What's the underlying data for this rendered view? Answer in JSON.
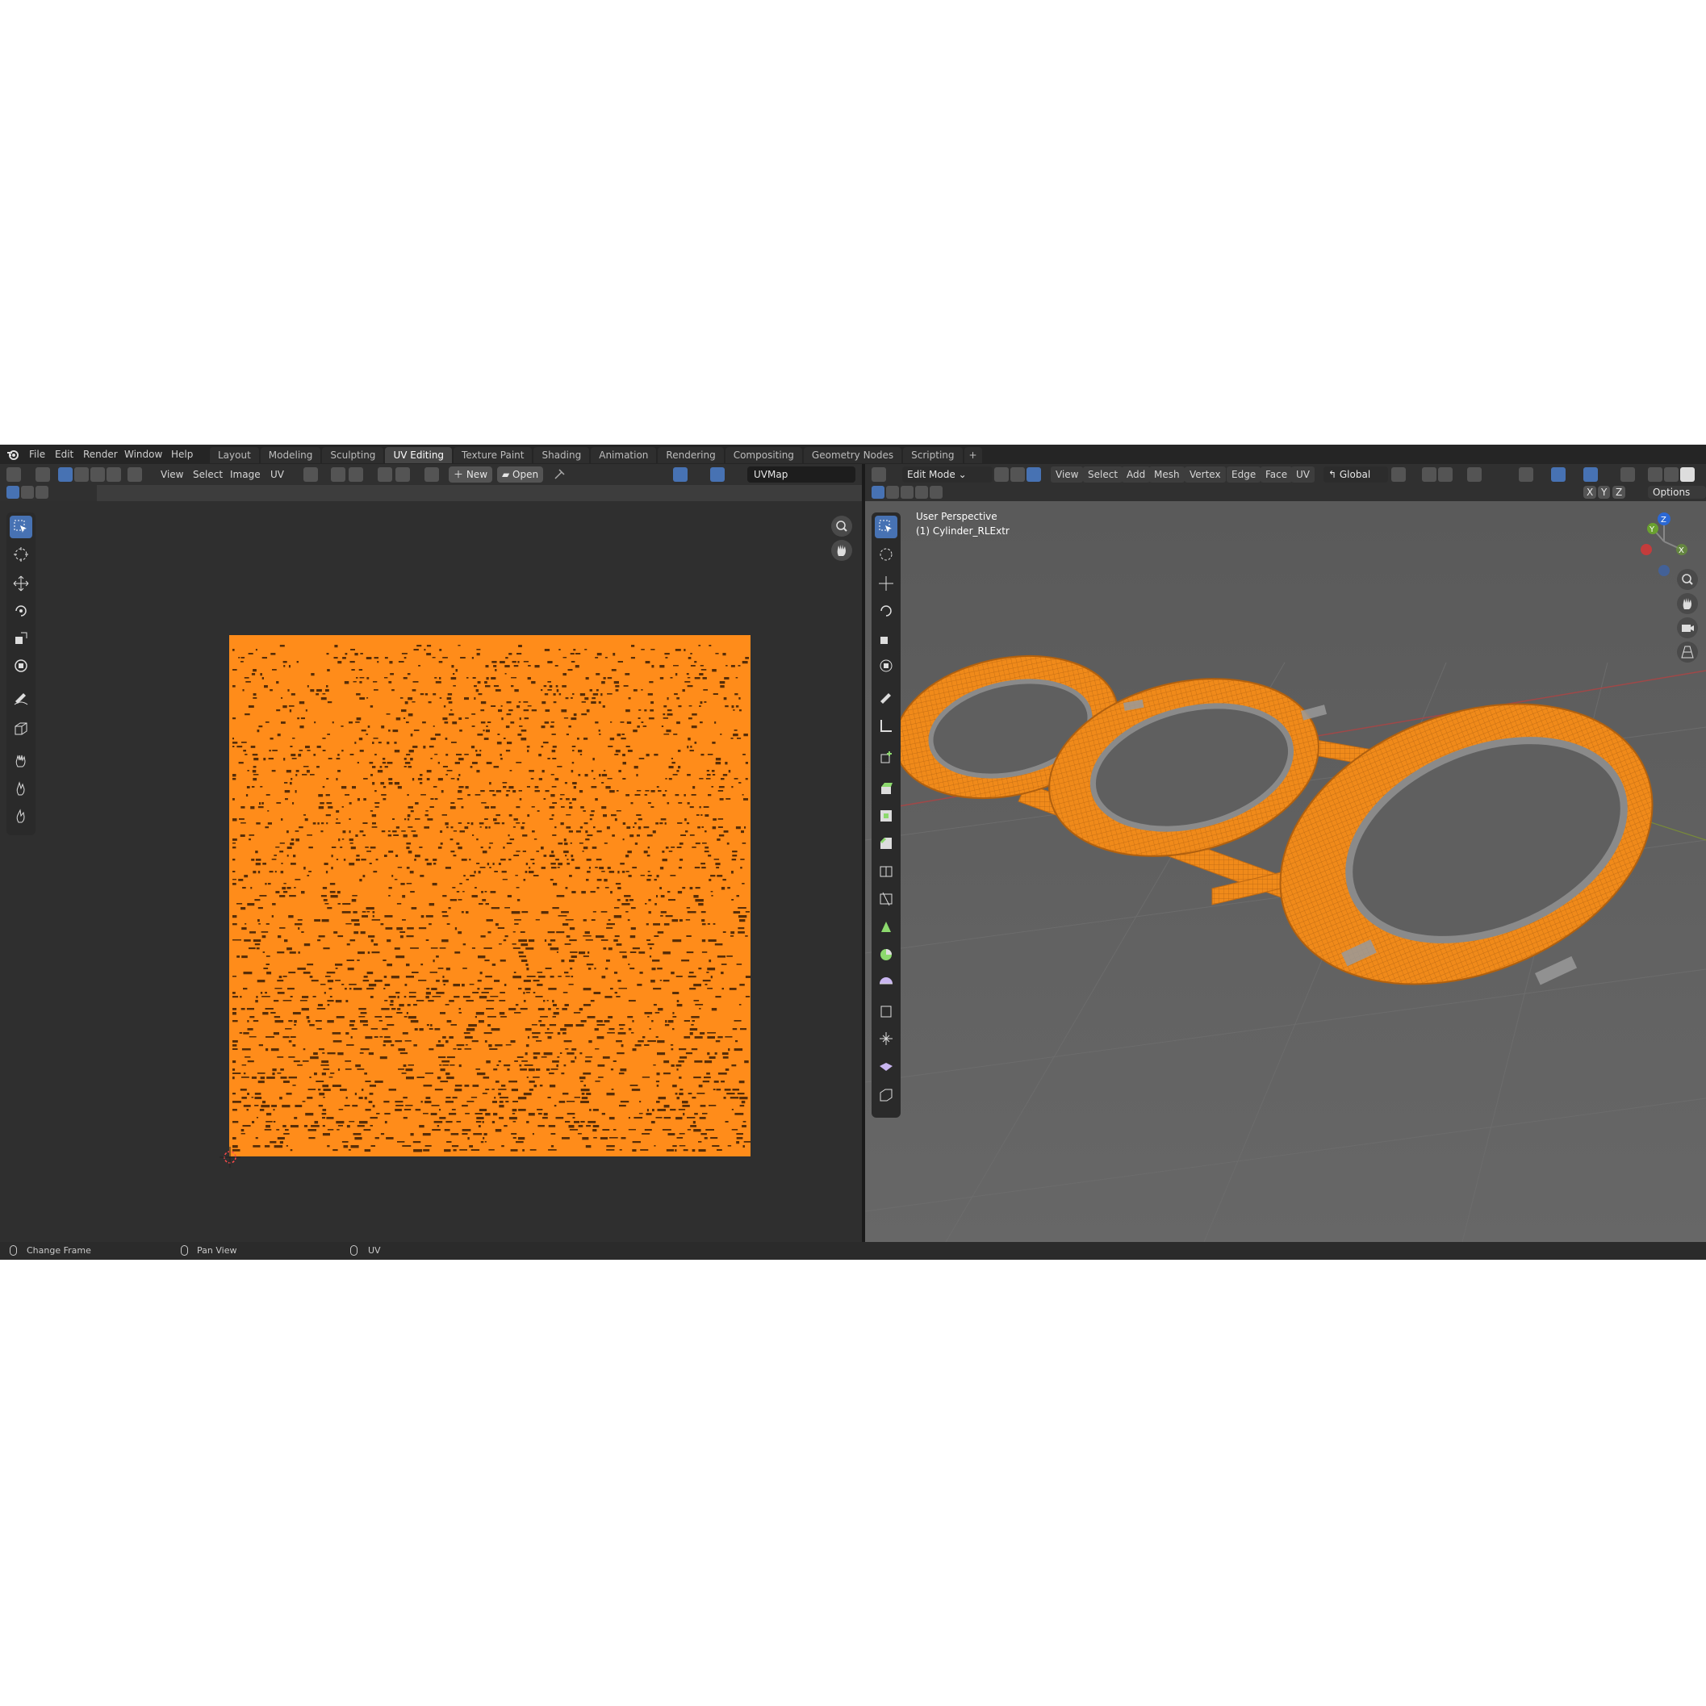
{
  "menu": [
    "File",
    "Edit",
    "Render",
    "Window",
    "Help"
  ],
  "tabs": [
    "Layout",
    "Modeling",
    "Sculpting",
    "UV Editing",
    "Texture Paint",
    "Shading",
    "Animation",
    "Rendering",
    "Compositing",
    "Geometry Nodes",
    "Scripting",
    "+"
  ],
  "active_tab": "UV Editing",
  "uv_header": {
    "menus": [
      "View",
      "Select",
      "Image",
      "UV"
    ],
    "new_label": "New",
    "open_label": "Open",
    "uvmap_value": "UVMap"
  },
  "viewport_header": {
    "mode_label": "Edit Mode",
    "menus": [
      "View",
      "Select",
      "Add",
      "Mesh",
      "Vertex",
      "Edge",
      "Face",
      "UV"
    ],
    "orientation_label": "Global",
    "axes": [
      "X",
      "Y",
      "Z"
    ],
    "options_label": "Options"
  },
  "viewport_overlay": {
    "perspective": "User Perspective",
    "object_name": "(1) Cylinder_RLExtr"
  },
  "gizmo_axes": {
    "z": "Z",
    "y": "Y",
    "x": "X"
  },
  "status_bar": [
    "Change Frame",
    "Pan View",
    "UV"
  ],
  "colors": {
    "accent_orange": "#ff8c1a",
    "selection_blue": "#4772b3",
    "uv_bg": "#2f2f2f",
    "viewport_bg": "#5f5f5f"
  }
}
